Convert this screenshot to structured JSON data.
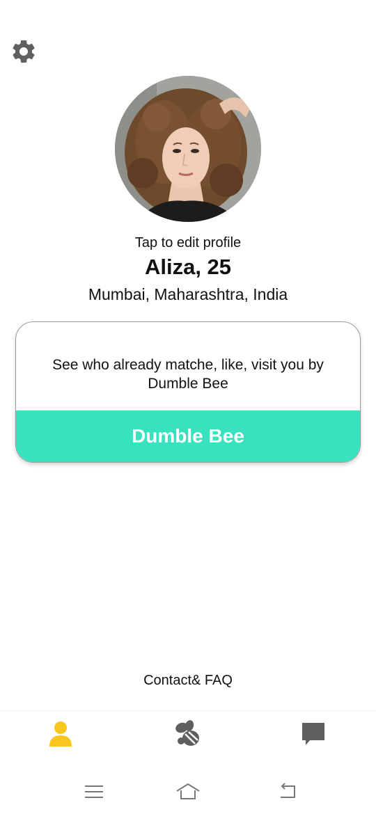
{
  "icons": {
    "settings": "gear-icon",
    "nav_profile": "person-icon",
    "nav_swipe": "bee-icon",
    "nav_chat": "chat-bubble-icon",
    "sys_menu": "menu-lines-icon",
    "sys_home": "home-icon",
    "sys_back": "back-arrow-icon"
  },
  "colors": {
    "accent_teal": "#38e2be",
    "active_yellow": "#f9c521",
    "icon_gray": "#5f5f5f"
  },
  "profile": {
    "avatar_alt": "Profile photo",
    "edit_hint": "Tap to edit profile",
    "name_age": "Aliza, 25",
    "location": "Mumbai, Maharashtra, India"
  },
  "promo": {
    "text": "See who already matche, like, visit you by Dumble Bee",
    "button_label": "Dumble Bee"
  },
  "footer": {
    "contact_label": "Contact& FAQ"
  },
  "bottom_nav": {
    "active": "profile",
    "items": [
      "profile",
      "swipe",
      "chats"
    ]
  }
}
